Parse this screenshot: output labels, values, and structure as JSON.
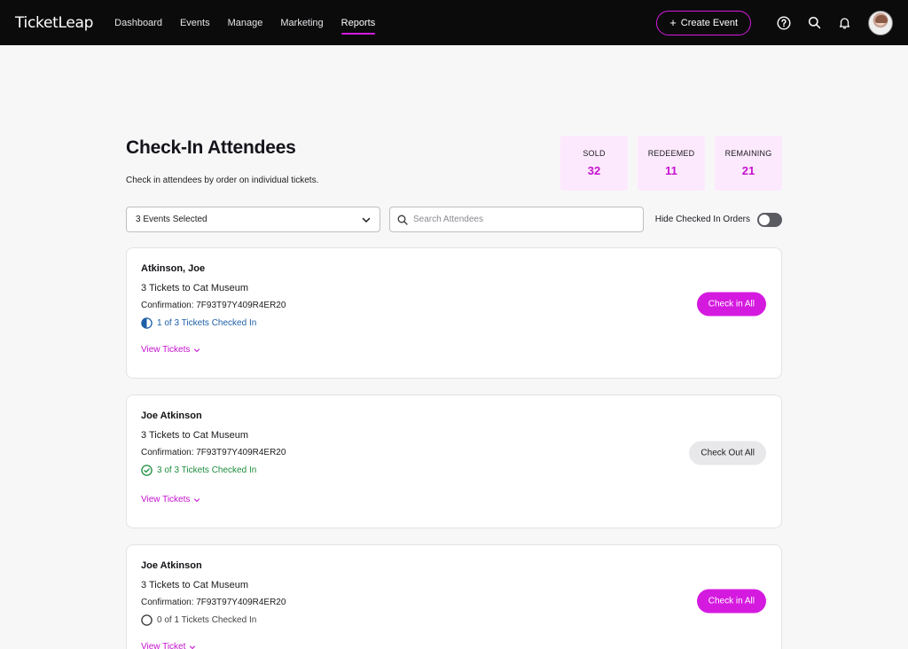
{
  "app": {
    "logo": "TicketLeap"
  },
  "nav": {
    "items": [
      {
        "label": "Dashboard"
      },
      {
        "label": "Events"
      },
      {
        "label": "Manage"
      },
      {
        "label": "Marketing"
      },
      {
        "label": "Reports"
      }
    ],
    "active": "Reports",
    "create_label": "Create Event"
  },
  "header": {
    "title": "Check-In Attendees",
    "subtitle": "Check in attendees by order on individual tickets."
  },
  "stats": {
    "sold": {
      "label": "SOLD",
      "value": "32"
    },
    "redeemed": {
      "label": "REDEEMED",
      "value": "11"
    },
    "remaining": {
      "label": "REMAINING",
      "value": "21"
    }
  },
  "filters": {
    "event_select": "3 Events Selected",
    "search_placeholder": "Search Attendees",
    "toggle_label": "Hide Checked In Orders",
    "toggle_on": false
  },
  "orders": [
    {
      "name": "Atkinson, Joe",
      "tickets": "3 Tickets to Cat Museum",
      "confirmation": "Confirmation: 7F93T97Y409R4ER20",
      "status": "1 of 3 Tickets Checked In",
      "view_label": "View Tickets",
      "action_label": "Check in All"
    },
    {
      "name": "Joe Atkinson",
      "tickets": "3 Tickets to Cat Museum",
      "confirmation": "Confirmation: 7F93T97Y409R4ER20",
      "status": "3 of 3 Tickets Checked In",
      "view_label": "View Tickets",
      "action_label": "Check Out All"
    },
    {
      "name": "Joe Atkinson",
      "tickets": "3 Tickets to Cat Museum",
      "confirmation": "Confirmation: 7F93T97Y409R4ER20",
      "status": "0 of 1 Tickets Checked In",
      "view_label": "View Ticket",
      "action_label": "Check in All"
    }
  ],
  "colors": {
    "accent": "#d51ae0",
    "stat_bg": "#fde9fd",
    "partial": "#1d5fa8",
    "complete": "#1d8c3c",
    "nav_bg": "#0b0b0c"
  },
  "icons": {
    "help": "help-circle-icon",
    "search": "search-icon",
    "notifications": "bell-icon",
    "dropdown": "chevron-down-icon"
  }
}
